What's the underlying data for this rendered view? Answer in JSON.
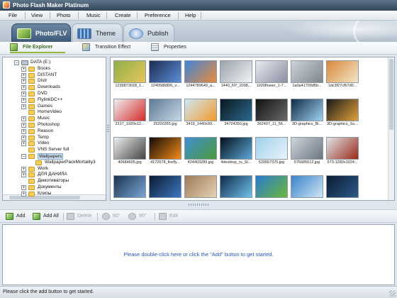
{
  "window": {
    "title": "Photo Flash Maker Platinum"
  },
  "menu": [
    "File",
    "View",
    "Photo",
    "Music",
    "Create",
    "Preference",
    "Help"
  ],
  "main_tabs": [
    {
      "label": "Photo/FLV",
      "active": true,
      "icon": "photo-icon"
    },
    {
      "label": "Theme",
      "active": false,
      "icon": "theme-icon"
    },
    {
      "label": "Publish",
      "active": false,
      "icon": "publish-icon"
    }
  ],
  "sub_tabs": [
    {
      "label": "File Explorer",
      "active": true,
      "icon": "file-explorer-icon"
    },
    {
      "label": "Transition Effect",
      "active": false,
      "icon": "transition-icon"
    },
    {
      "label": "Properties",
      "active": false,
      "icon": "properties-icon"
    }
  ],
  "tree": {
    "items": [
      {
        "label": "DATA (E:)",
        "type": "drive",
        "expanded": true
      },
      {
        "label": "Books",
        "type": "folder",
        "expanded": false
      },
      {
        "label": "DISTANT",
        "type": "folder",
        "expanded": false
      },
      {
        "label": "Distr",
        "type": "folder",
        "expanded": false
      },
      {
        "label": "Downloads",
        "type": "folder",
        "expanded": false
      },
      {
        "label": "DVD",
        "type": "folder",
        "expanded": false
      },
      {
        "label": "FlylinkDC++",
        "type": "folder",
        "expanded": false
      },
      {
        "label": "Games",
        "type": "folder",
        "expanded": false
      },
      {
        "label": "HomeVideo",
        "type": "folder",
        "expanded": null
      },
      {
        "label": "Music",
        "type": "folder",
        "expanded": false
      },
      {
        "label": "Photoshop",
        "type": "folder",
        "expanded": false
      },
      {
        "label": "Reason",
        "type": "folder",
        "expanded": false
      },
      {
        "label": "Temp",
        "type": "folder",
        "expanded": false
      },
      {
        "label": "Video",
        "type": "folder",
        "expanded": false
      },
      {
        "label": "VNS Server full",
        "type": "folder",
        "expanded": null
      },
      {
        "label": "Wallpapers",
        "type": "folder",
        "expanded": true,
        "selected": true
      },
      {
        "label": "WallpaperPackMortality3",
        "type": "folder",
        "expanded": null,
        "child": true
      },
      {
        "label": "Work",
        "type": "folder",
        "expanded": false
      },
      {
        "label": "ДЛЯ ДАНИЛА",
        "type": "folder",
        "expanded": false
      },
      {
        "label": "Демотиваторы",
        "type": "folder",
        "expanded": null
      },
      {
        "label": "Документы",
        "type": "folder",
        "expanded": false
      },
      {
        "label": "Клипы",
        "type": "folder",
        "expanded": false
      }
    ]
  },
  "thumbnails": [
    {
      "caption": "1239873018_1...",
      "colors": [
        "#8fb04a",
        "#e8c55a"
      ]
    },
    {
      "caption": "1240586806_v...",
      "colors": [
        "#1d2c52",
        "#5d8fd8"
      ]
    },
    {
      "caption": "1244789649_a...",
      "colors": [
        "#3f84d8",
        "#e88b3a"
      ]
    },
    {
      "caption": "1440_NY_2008...",
      "colors": [
        "#9aa2aa",
        "#f2f3f5"
      ]
    },
    {
      "caption": "1920flower_1-7...",
      "colors": [
        "#e9e9ef",
        "#8b8fa0"
      ]
    },
    {
      "caption": "1a0a41700d5b...",
      "colors": [
        "#cdd3d8",
        "#7f868c"
      ]
    },
    {
      "caption": "1dc3f27cfb7d0...",
      "colors": [
        "#d8893a",
        "#f2e6c8"
      ]
    },
    {
      "caption": "2317_1920x12...",
      "colors": [
        "#f0f0f0",
        "#d32a2a"
      ]
    },
    {
      "caption": "25200355.jpg",
      "colors": [
        "#5d7a96",
        "#c7d6e4"
      ]
    },
    {
      "caption": "3419_1440x90...",
      "colors": [
        "#cfe8f5",
        "#f29a2a"
      ]
    },
    {
      "caption": "34724350.jpg",
      "colors": [
        "#0b1720",
        "#2b6a8c"
      ]
    },
    {
      "caption": "362407_11_56...",
      "colors": [
        "#111111",
        "#6a6a6a"
      ]
    },
    {
      "caption": "3D-graphics_Bl...",
      "colors": [
        "#0f2a45",
        "#9fd3f2"
      ]
    },
    {
      "caption": "3D-graphics_Su...",
      "colors": [
        "#1a1a1a",
        "#e0a23a"
      ]
    },
    {
      "caption": "40684605.jpg",
      "colors": [
        "#eeeeee",
        "#444444"
      ]
    },
    {
      "caption": "4172678_firefly...",
      "colors": [
        "#140a05",
        "#f28c1a"
      ]
    },
    {
      "caption": "424403289.jpg",
      "colors": [
        "#3d8fd6",
        "#4d9a3a"
      ]
    },
    {
      "caption": "4desktop_ru_St...",
      "colors": [
        "#05101a",
        "#5ca8d8"
      ]
    },
    {
      "caption": "520567370.jpg",
      "colors": [
        "#9fd0ea",
        "#e8f4fa"
      ]
    },
    {
      "caption": "576685612.jpg",
      "colors": [
        "#cfd6dc",
        "#6b7680"
      ]
    },
    {
      "caption": "573-1280x1024...",
      "colors": [
        "#e0e4e8",
        "#9a2a1a"
      ]
    },
    {
      "caption": "",
      "colors": [
        "#1c3350",
        "#7aa6d2"
      ]
    },
    {
      "caption": "",
      "colors": [
        "#0a1a30",
        "#3c78c2"
      ]
    },
    {
      "caption": "",
      "colors": [
        "#9c7a58",
        "#e6d2b4"
      ]
    },
    {
      "caption": "",
      "colors": [
        "#0e2a4a",
        "#6fc2ea"
      ]
    },
    {
      "caption": "",
      "colors": [
        "#2a7ad2",
        "#6ab83a"
      ]
    },
    {
      "caption": "",
      "colors": [
        "#3a82c8",
        "#cfe6f6"
      ]
    },
    {
      "caption": "",
      "colors": [
        "#0c1c30",
        "#2c5a8a"
      ]
    }
  ],
  "toolbar": {
    "buttons": [
      {
        "label": "Add",
        "enabled": true,
        "icon": "add-icon"
      },
      {
        "label": "Add All",
        "enabled": true,
        "icon": "add-all-icon"
      },
      {
        "label": "Delete",
        "enabled": false,
        "icon": "delete-icon"
      },
      {
        "label": "90°",
        "enabled": false,
        "icon": "rotate-left-icon"
      },
      {
        "label": "90°",
        "enabled": false,
        "icon": "rotate-right-icon"
      },
      {
        "label": "Edit",
        "enabled": false,
        "icon": "edit-icon"
      }
    ]
  },
  "drop_zone": {
    "hint": "Please double-click here or click the \"Add\" button to get started."
  },
  "status": {
    "text": "Please click the add button to get started."
  }
}
